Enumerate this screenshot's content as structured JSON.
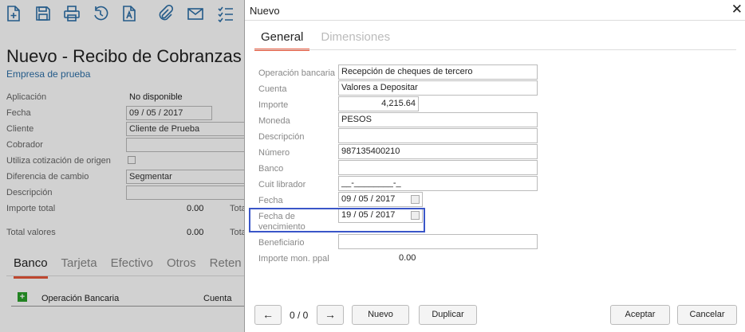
{
  "background": {
    "toolbar": {
      "icons": [
        "new-document-icon",
        "save-icon",
        "print-icon",
        "history-icon",
        "text-document-icon",
        "attachment-icon",
        "email-icon",
        "checklist-icon"
      ]
    },
    "title": "Nuevo - Recibo de Cobranzas",
    "company": "Empresa de prueba",
    "fields": {
      "aplicacion_label": "Aplicación",
      "aplicacion_value": "No disponible",
      "fecha_label": "Fecha",
      "fecha_day": "09",
      "fecha_month": "05",
      "fecha_year": "2017",
      "cliente_label": "Cliente",
      "cliente_value": "Cliente de Prueba",
      "cobrador_label": "Cobrador",
      "cotizacion_label": "Utiliza cotización de origen",
      "diferencia_label": "Diferencia de cambio",
      "diferencia_value": "Segmentar",
      "descripcion_label": "Descripción",
      "importe_total_label": "Importe total",
      "importe_total_value": "0.00",
      "importe_total_right": "Tota",
      "total_valores_label": "Total valores",
      "total_valores_value": "0.00",
      "total_valores_right": "Tota"
    },
    "tabs": [
      "Banco",
      "Tarjeta",
      "Efectivo",
      "Otros",
      "Reten"
    ],
    "grid": {
      "col_operacion": "Operación Bancaria",
      "col_cuenta": "Cuenta",
      "add_icon": "add-icon"
    }
  },
  "dialog": {
    "title": "Nuevo",
    "close": "✕",
    "tabs": {
      "general": "General",
      "dimensiones": "Dimensiones"
    },
    "fields": {
      "operacion_label": "Operación bancaria",
      "operacion_value": "Recepción de cheques de tercero",
      "cuenta_label": "Cuenta",
      "cuenta_value": "Valores a Depositar",
      "importe_label": "Importe",
      "importe_value": "4,215.64",
      "moneda_label": "Moneda",
      "moneda_value": "PESOS",
      "descripcion_label": "Descripción",
      "descripcion_value": "",
      "numero_label": "Número",
      "numero_value": "987135400210",
      "banco_label": "Banco",
      "banco_value": "",
      "cuit_label": "Cuit librador",
      "cuit_value": "__-________-_",
      "fecha_label": "Fecha",
      "fecha_day": "09",
      "fecha_month": "05",
      "fecha_year": "2017",
      "vencimiento_label_1": "Fecha de",
      "vencimiento_label_2": "vencimiento",
      "vencimiento_day": "19",
      "vencimiento_month": "05",
      "vencimiento_year": "2017",
      "beneficiario_label": "Beneficiario",
      "beneficiario_value": "",
      "importe_ppal_label": "Importe mon. ppal",
      "importe_ppal_value": "0.00"
    },
    "footer": {
      "prev": "←",
      "pager": "0 / 0",
      "next": "→",
      "nuevo": "Nuevo",
      "duplicar": "Duplicar",
      "aceptar": "Aceptar",
      "cancelar": "Cancelar"
    }
  }
}
